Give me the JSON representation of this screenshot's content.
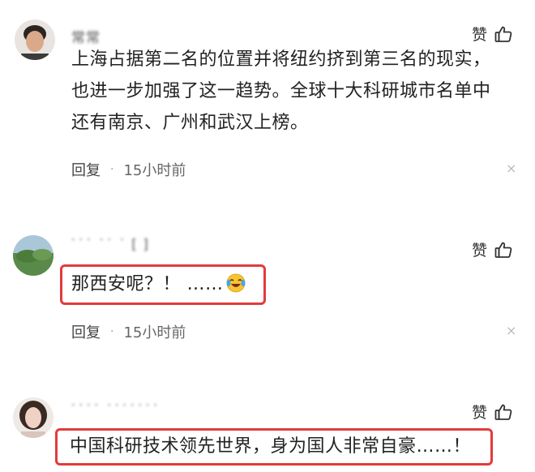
{
  "comments": [
    {
      "username": "常常",
      "like_label": "赞",
      "content_lines": [
        "上海占据第二名的位置并将纽约挤到第三名的现实，",
        "也进一步加强了这一趋势。全球十大科研城市名单中",
        "还有南京、广州和武汉上榜。"
      ],
      "reply_label": "回复",
      "separator": "·",
      "time": "15小时前",
      "close_symbol": "×"
    },
    {
      "username": "˙˙˙ ˙˙ ˙ [ ]",
      "like_label": "赞",
      "content": "那西安呢？！ ……",
      "emoji": "laughing-crying-emoji",
      "reply_label": "回复",
      "separator": "·",
      "time": "15小时前",
      "close_symbol": "×"
    },
    {
      "username": "˙˙˙˙ ˙˙˙˙˙˙˙",
      "like_label": "赞",
      "content": "中国科研技术领先世界，身为国人非常自豪……！"
    }
  ],
  "colors": {
    "highlight": "#e23b3b",
    "text": "#222222",
    "meta": "#666666"
  },
  "icons": [
    "thumbs-up-icon",
    "close-icon",
    "laughing-crying-emoji"
  ]
}
